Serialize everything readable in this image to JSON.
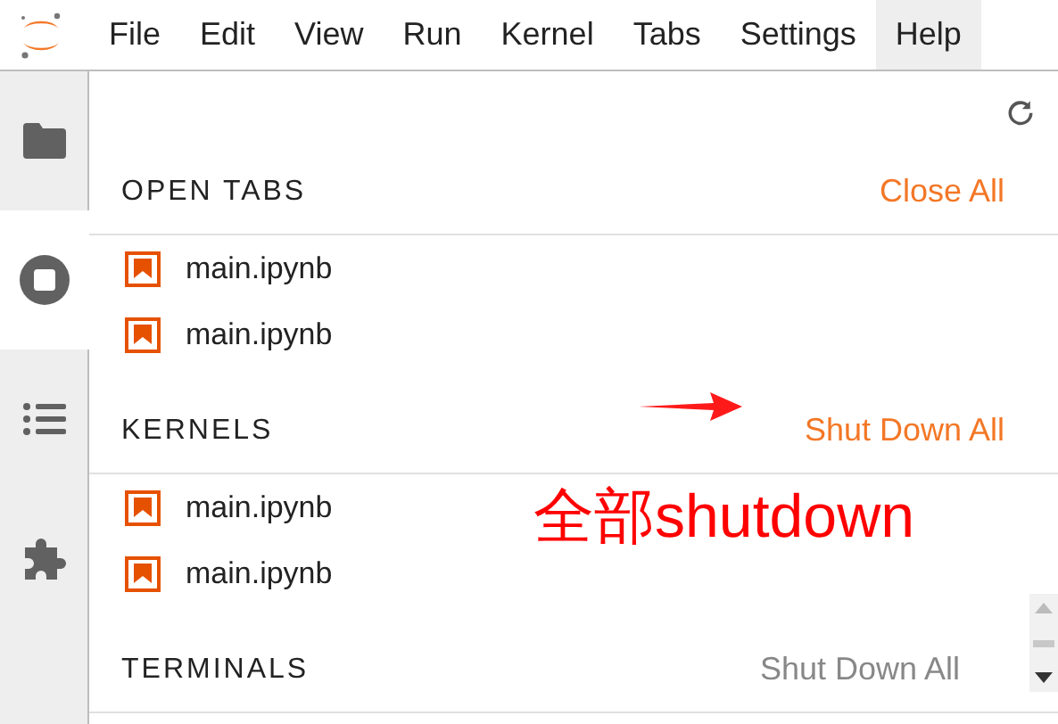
{
  "menu": [
    {
      "label": "File",
      "selected": false
    },
    {
      "label": "Edit",
      "selected": false
    },
    {
      "label": "View",
      "selected": false
    },
    {
      "label": "Run",
      "selected": false
    },
    {
      "label": "Kernel",
      "selected": false
    },
    {
      "label": "Tabs",
      "selected": false
    },
    {
      "label": "Settings",
      "selected": false
    },
    {
      "label": "Help",
      "selected": true
    }
  ],
  "sidebar_tabs": [
    {
      "kind": "folder",
      "selected": false
    },
    {
      "kind": "running",
      "selected": true
    },
    {
      "kind": "toc",
      "selected": false
    },
    {
      "kind": "extensions",
      "selected": false
    }
  ],
  "sections": [
    {
      "title": "OPEN TABS",
      "action": "Close All",
      "disabled": false,
      "items": [
        "main.ipynb",
        "main.ipynb"
      ]
    },
    {
      "title": "KERNELS",
      "action": "Shut Down All",
      "disabled": false,
      "items": [
        "main.ipynb",
        "main.ipynb"
      ]
    },
    {
      "title": "TERMINALS",
      "action": "Shut Down All",
      "disabled": true
    }
  ],
  "annotation": {
    "text": "全部shutdown"
  }
}
